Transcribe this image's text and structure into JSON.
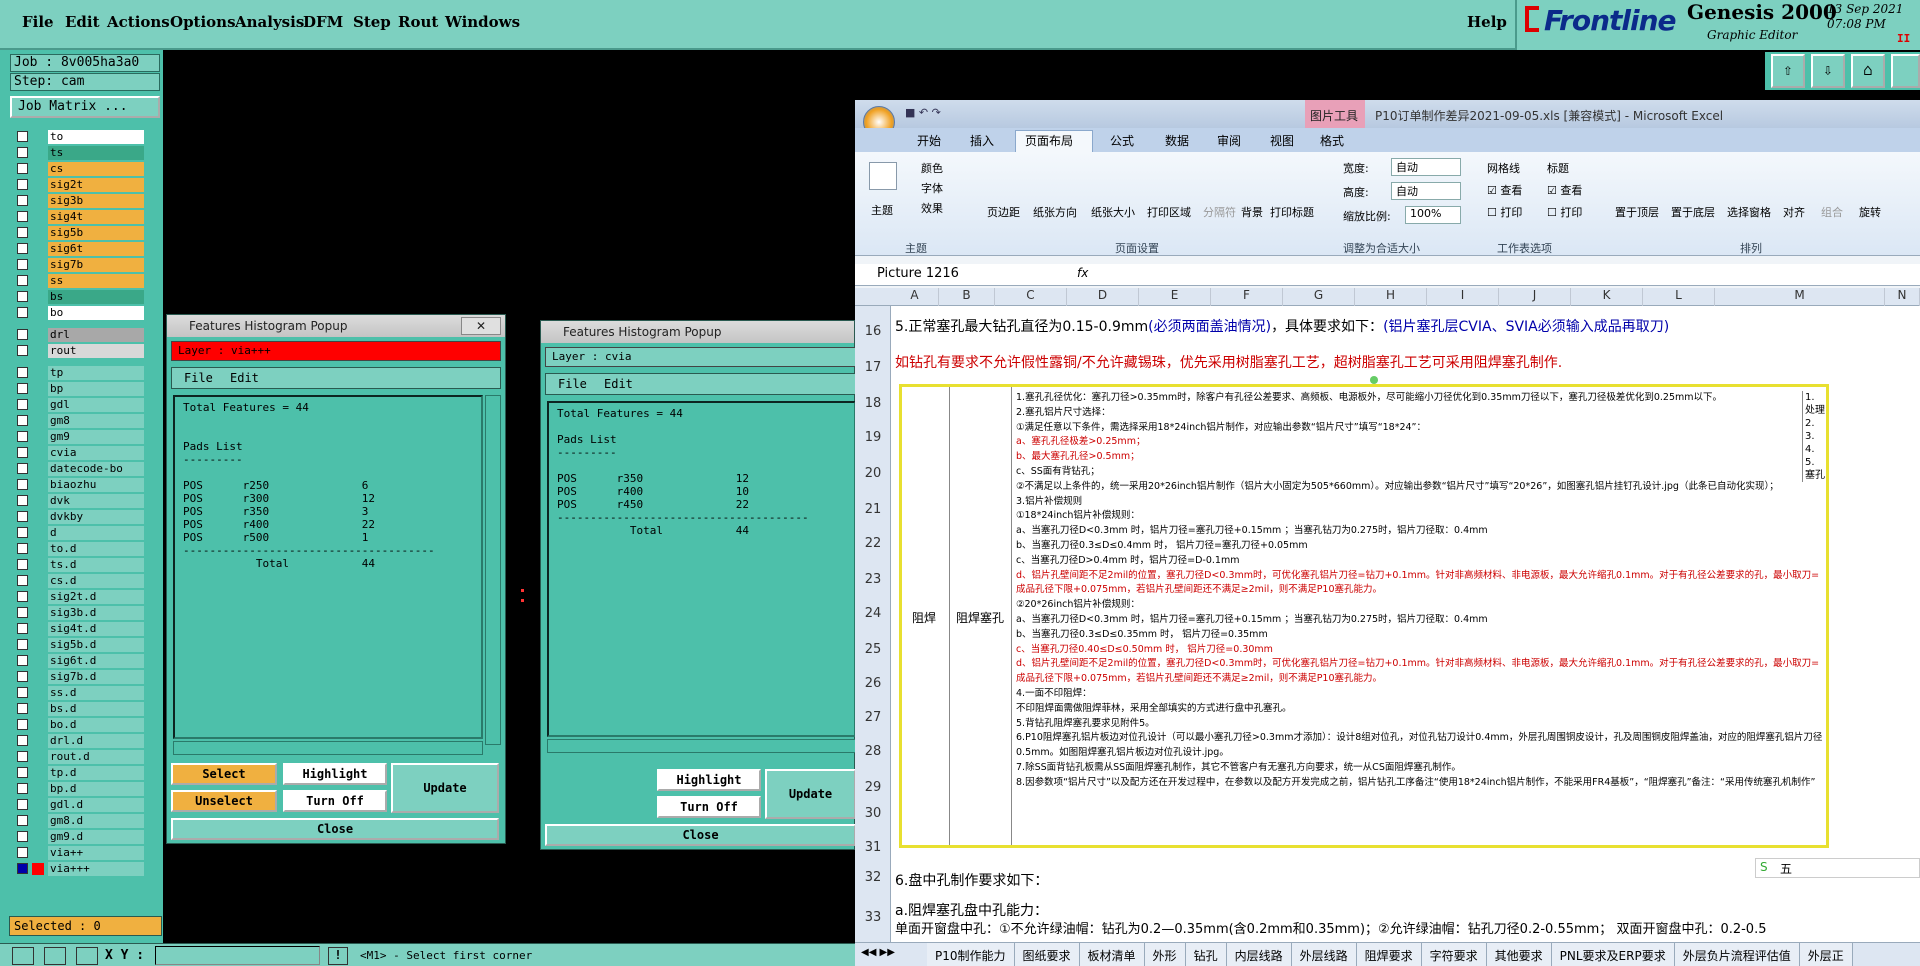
{
  "menu": [
    "File",
    "Edit",
    "Actions",
    "Options",
    "Analysis",
    "DFM",
    "Step",
    "Rout",
    "Windows"
  ],
  "help": "Help",
  "brand": {
    "logo": "Frontline",
    "product": "Genesis 2000",
    "subtitle": "Graphic Editor",
    "date": "13 Sep 2021",
    "time": "07:08 PM",
    "indicator": "II"
  },
  "job": {
    "job_line": "Job : 8v005ha3a0",
    "step_line": "Step: cam",
    "matrix_btn": "Job Matrix ..."
  },
  "layers": [
    {
      "name": "to",
      "color": "#ffffff"
    },
    {
      "name": "ts",
      "color": "#3aa888"
    },
    {
      "name": "cs",
      "color": "#f0b040"
    },
    {
      "name": "sig2t",
      "color": "#f0b040"
    },
    {
      "name": "sig3b",
      "color": "#f0b040"
    },
    {
      "name": "sig4t",
      "color": "#f0b040"
    },
    {
      "name": "sig5b",
      "color": "#f0b040"
    },
    {
      "name": "sig6t",
      "color": "#f0b040"
    },
    {
      "name": "sig7b",
      "color": "#f0b040"
    },
    {
      "name": "ss",
      "color": "#f0b040"
    },
    {
      "name": "bs",
      "color": "#3aa888"
    },
    {
      "name": "bo",
      "color": "#ffffff"
    },
    {
      "name": "drl",
      "color": "#a8a8a8"
    },
    {
      "name": "rout",
      "color": "#d8d8d8"
    },
    {
      "name": "tp",
      "color": "#7dd0c0"
    },
    {
      "name": "bp",
      "color": "#7dd0c0"
    },
    {
      "name": "gdl",
      "color": "#7dd0c0"
    },
    {
      "name": "gm8",
      "color": "#7dd0c0"
    },
    {
      "name": "gm9",
      "color": "#7dd0c0"
    },
    {
      "name": "cvia",
      "color": "#7dd0c0"
    },
    {
      "name": "datecode-bo",
      "color": "#7dd0c0"
    },
    {
      "name": "biaozhu",
      "color": "#7dd0c0"
    },
    {
      "name": "dvk",
      "color": "#7dd0c0"
    },
    {
      "name": "dvkby",
      "color": "#7dd0c0"
    },
    {
      "name": "d",
      "color": "#7dd0c0"
    },
    {
      "name": "to.d",
      "color": "#7dd0c0"
    },
    {
      "name": "ts.d",
      "color": "#7dd0c0"
    },
    {
      "name": "cs.d",
      "color": "#7dd0c0"
    },
    {
      "name": "sig2t.d",
      "color": "#7dd0c0"
    },
    {
      "name": "sig3b.d",
      "color": "#7dd0c0"
    },
    {
      "name": "sig4t.d",
      "color": "#7dd0c0"
    },
    {
      "name": "sig5b.d",
      "color": "#7dd0c0"
    },
    {
      "name": "sig6t.d",
      "color": "#7dd0c0"
    },
    {
      "name": "sig7b.d",
      "color": "#7dd0c0"
    },
    {
      "name": "ss.d",
      "color": "#7dd0c0"
    },
    {
      "name": "bs.d",
      "color": "#7dd0c0"
    },
    {
      "name": "bo.d",
      "color": "#7dd0c0"
    },
    {
      "name": "drl.d",
      "color": "#7dd0c0"
    },
    {
      "name": "rout.d",
      "color": "#7dd0c0"
    },
    {
      "name": "tp.d",
      "color": "#7dd0c0"
    },
    {
      "name": "bp.d",
      "color": "#7dd0c0"
    },
    {
      "name": "gdl.d",
      "color": "#7dd0c0"
    },
    {
      "name": "gm8.d",
      "color": "#7dd0c0"
    },
    {
      "name": "gm9.d",
      "color": "#7dd0c0"
    },
    {
      "name": "via++",
      "color": "#7dd0c0"
    },
    {
      "name": "via+++",
      "color": "#7dd0c0"
    }
  ],
  "selected": "Selected : 0",
  "xy_label": "X Y :",
  "status_msg": "<M1> - Select first corner",
  "popup1": {
    "title": "Features Histogram Popup",
    "layer": "Layer :  via+++",
    "file": "File",
    "edit": "Edit",
    "body": "Total Features = 44\n\n\nPads List\n---------\n\nPOS      r250              6\nPOS      r300              12\nPOS      r350              3\nPOS      r400              22\nPOS      r500              1\n--------------------------------------\n           Total           44",
    "select": "Select",
    "unselect": "Unselect",
    "highlight": "Highlight",
    "turnoff": "Turn Off",
    "update": "Update",
    "close": "Close"
  },
  "popup2": {
    "title": "Features Histogram Popup",
    "layer": "Layer :  cvia",
    "file": "File",
    "edit": "Edit",
    "body": "Total Features = 44\n\nPads List\n---------\n\nPOS      r350              12\nPOS      r400              10\nPOS      r450              22\n--------------------------------------\n           Total           44",
    "highlight": "Highlight",
    "turnoff": "Turn Off",
    "update": "Update",
    "close": "Close"
  },
  "excel": {
    "title": "P10订单制作差异2021-09-05.xls [兼容模式] - Microsoft Excel",
    "tool_ctx": "图片工具",
    "tabs": [
      "开始",
      "插入",
      "页面布局",
      "公式",
      "数据",
      "审阅",
      "视图",
      "格式"
    ],
    "ribbon_groups": [
      "主题",
      "页面设置",
      "调整为合适大小",
      "工作表选项",
      "排列"
    ],
    "ribbon_items": {
      "theme": "主题",
      "colors": "颜色",
      "fonts": "字体",
      "effects": "效果",
      "margins": "页边距",
      "orient": "纸张方向",
      "size": "纸张大小",
      "printarea": "打印区域",
      "breaks": "分隔符",
      "bg": "背景",
      "titles": "打印标题",
      "width": "宽度:",
      "height": "高度:",
      "scale": "缩放比例:",
      "auto1": "自动",
      "auto2": "自动",
      "pct": "100%",
      "gridlines": "网格线",
      "headings": "标题",
      "view1": "查看",
      "view2": "查看",
      "print1": "打印",
      "print2": "打印",
      "front": "置于顶层",
      "back": "置于底层",
      "pane": "选择窗格",
      "align": "对齐",
      "group": "组合",
      "rotate": "旋转"
    },
    "namebox": "Picture 1216",
    "fx": "fx",
    "cols": [
      "A",
      "B",
      "C",
      "D",
      "E",
      "F",
      "G",
      "H",
      "I",
      "J",
      "K",
      "L",
      "M",
      "N"
    ],
    "rows": [
      "16",
      "17",
      "18",
      "19",
      "20",
      "21",
      "22",
      "23",
      "24",
      "25",
      "26",
      "27",
      "28",
      "29",
      "30",
      "31",
      "32",
      "33"
    ],
    "r16a": "5.正常塞孔最大钻孔直径为0.15-0.9mm",
    "r16b": "(必须两面盖油情况)",
    "r16c": "，具体要求如下：",
    "r16d": "(铝片塞孔层CVIA、SVIA必须输入成品再取刀)",
    "r17": "如钻孔有要求不允许假性露铜/不允许藏锡珠，优先采用树脂塞孔工艺，超树脂塞孔工艺可采用阻焊塞孔制作.",
    "colA": "阻焊",
    "colB": "阻焊塞孔",
    "pic_lines": [
      {
        "t": "1.塞孔孔径优化：塞孔刀径>0.35mm时，除客户有孔径公差要求、高频板、电源板外，尽可能缩小刀径优化到0.35mm刀径以下，塞孔刀径极差优化到0.25mm以下。",
        "c": "#000"
      },
      {
        "t": "2.塞孔铝片尺寸选择：",
        "c": "#000"
      },
      {
        "t": "①满足任意以下条件，需选择采用18*24inch铝片制作，对应输出参数“铝片尺寸”填写“18*24”：",
        "c": "#000"
      },
      {
        "t": "a、塞孔孔径极差>0.25mm；",
        "c": "#c00"
      },
      {
        "t": "b、最大塞孔孔径>0.5mm；",
        "c": "#c00"
      },
      {
        "t": "c、SS面有背钻孔；",
        "c": "#000"
      },
      {
        "t": "②不满足以上条件的，统一采用20*26inch铝片制作（铝片大小固定为505*660mm）。对应输出参数“铝片尺寸”填写“20*26”，如图塞孔铝片挂钉孔设计.jpg（此条已自动化实现）；",
        "c": "#000"
      },
      {
        "t": "3.铝片补偿规则",
        "c": "#000"
      },
      {
        "t": "①18*24inch铝片补偿规则：",
        "c": "#000"
      },
      {
        "t": "a、当塞孔刀径D<0.3mm 时，铝片刀径=塞孔刀径+0.15mm ；当塞孔钻刀为0.275时，铝片刀径取：0.4mm",
        "c": "#000"
      },
      {
        "t": "b、当塞孔刀径0.3≤D≤0.4mm 时，  铝片刀径=塞孔刀径+0.05mm",
        "c": "#000"
      },
      {
        "t": "c、当塞孔刀径D>0.4mm 时，铝片刀径=D-0.1mm",
        "c": "#000"
      },
      {
        "t": "d、铝片孔壁间距不足2mil的位置，塞孔刀径D<0.3mm时，可优化塞孔铝片刀径=钻刀+0.1mm。针对非高频材料、非电源板，最大允许缩孔0.1mm。对于有孔径公差要求的孔，最小取刀=成品孔径下限+0.075mm，若铝片孔壁间距还不满足≥2mil，则不满足P10塞孔能力。",
        "c": "#c00"
      },
      {
        "t": "②20*26inch铝片补偿规则：",
        "c": "#000"
      },
      {
        "t": "a、当塞孔刀径D<0.3mm 时，铝片刀径=塞孔刀径+0.15mm ；当塞孔钻刀为0.275时，铝片刀径取：0.4mm",
        "c": "#000"
      },
      {
        "t": "b、当塞孔刀径0.3≤D≤0.35mm 时，  铝片刀径=0.35mm",
        "c": "#000"
      },
      {
        "t": "c、当塞孔刀径0.40≤D≤0.50mm 时，  铝片刀径=0.30mm",
        "c": "#c00"
      },
      {
        "t": "d、铝片孔壁间距不足2mil的位置，塞孔刀径D<0.3mm时，可优化塞孔铝片刀径=钻刀+0.1mm。针对非高频材料、非电源板，最大允许缩孔0.1mm。对于有孔径公差要求的孔，最小取刀=成品孔径下限+0.075mm，若铝片孔壁间距还不满足≥2mil，则不满足P10塞孔能力。",
        "c": "#c00"
      },
      {
        "t": "4.一面不印阻焊：",
        "c": "#000"
      },
      {
        "t": "不印阻焊面需做阻焊菲林，采用全部填实的方式进行盘中孔塞孔。",
        "c": "#000"
      },
      {
        "t": "5.背钻孔阻焊塞孔要求见附件5。",
        "c": "#000"
      },
      {
        "t": "6.P10阻焊塞孔铝片板边对位孔设计（可以最小塞孔刀径>0.3mm才添加）：设计8组对位孔，对位孔钻刀设计0.4mm，外层孔周围铜皮设计，孔及周围铜皮阻焊盖油，对应的阻焊塞孔铝片刀径0.5mm。如图阻焊塞孔铝片板边对位孔设计.jpg。",
        "c": "#000"
      },
      {
        "t": "7.除SS面背钻孔板需从SS面阻焊塞孔制作，其它不管客户有无塞孔方向要求，统一从CS面阻焊塞孔制作。",
        "c": "#000"
      },
      {
        "t": "8.因参数项“铝片尺寸”以及配方还在开发过程中，在参数以及配方开发完成之前，铝片钻孔工序备注“使用18*24inch铝片制作，不能采用FR4基板”，“阻焊塞孔”备注：“采用传统塞孔机制作”",
        "c": "#000"
      }
    ],
    "m_col": [
      "1.",
      "处理",
      "2.",
      "3.",
      "4.",
      "5.",
      "塞孔"
    ],
    "r32": "6.盘中孔制作要求如下：",
    "r33a": "a.阻焊塞孔盘中孔能力：",
    "r33b": "单面开窗盘中孔：①不允许绿油帽：钻孔为0.2—0.35mm(含0.2mm和0.35mm)；②允许绿油帽：钻孔刀径0.2-0.55mm；      双面开窗盘中孔：0.2-0.5",
    "ime": "五",
    "sheets": [
      "P10制作能力",
      "图纸要求",
      "板材清单",
      "外形",
      "钻孔",
      "内层线路",
      "外层线路",
      "阻焊要求",
      "字符要求",
      "其他要求",
      "PNL要求及ERP要求",
      "外层负片流程评估值",
      "外层正"
    ]
  }
}
